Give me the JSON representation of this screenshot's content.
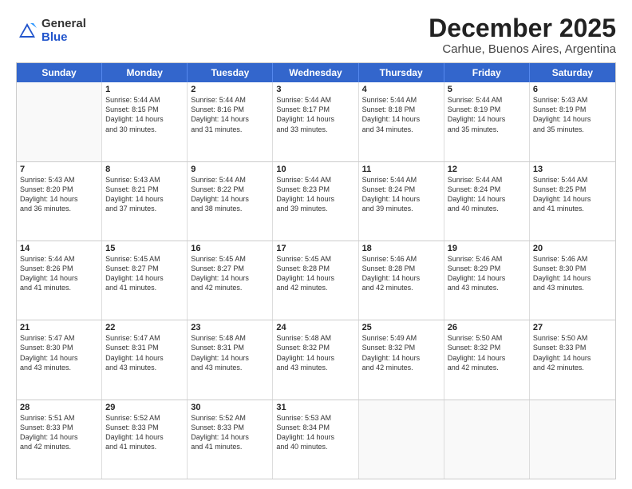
{
  "logo": {
    "general": "General",
    "blue": "Blue"
  },
  "title": "December 2025",
  "subtitle": "Carhue, Buenos Aires, Argentina",
  "days": [
    "Sunday",
    "Monday",
    "Tuesday",
    "Wednesday",
    "Thursday",
    "Friday",
    "Saturday"
  ],
  "weeks": [
    [
      {
        "day": "",
        "lines": []
      },
      {
        "day": "1",
        "lines": [
          "Sunrise: 5:44 AM",
          "Sunset: 8:15 PM",
          "Daylight: 14 hours",
          "and 30 minutes."
        ]
      },
      {
        "day": "2",
        "lines": [
          "Sunrise: 5:44 AM",
          "Sunset: 8:16 PM",
          "Daylight: 14 hours",
          "and 31 minutes."
        ]
      },
      {
        "day": "3",
        "lines": [
          "Sunrise: 5:44 AM",
          "Sunset: 8:17 PM",
          "Daylight: 14 hours",
          "and 33 minutes."
        ]
      },
      {
        "day": "4",
        "lines": [
          "Sunrise: 5:44 AM",
          "Sunset: 8:18 PM",
          "Daylight: 14 hours",
          "and 34 minutes."
        ]
      },
      {
        "day": "5",
        "lines": [
          "Sunrise: 5:44 AM",
          "Sunset: 8:19 PM",
          "Daylight: 14 hours",
          "and 35 minutes."
        ]
      },
      {
        "day": "6",
        "lines": [
          "Sunrise: 5:43 AM",
          "Sunset: 8:19 PM",
          "Daylight: 14 hours",
          "and 35 minutes."
        ]
      }
    ],
    [
      {
        "day": "7",
        "lines": [
          "Sunrise: 5:43 AM",
          "Sunset: 8:20 PM",
          "Daylight: 14 hours",
          "and 36 minutes."
        ]
      },
      {
        "day": "8",
        "lines": [
          "Sunrise: 5:43 AM",
          "Sunset: 8:21 PM",
          "Daylight: 14 hours",
          "and 37 minutes."
        ]
      },
      {
        "day": "9",
        "lines": [
          "Sunrise: 5:44 AM",
          "Sunset: 8:22 PM",
          "Daylight: 14 hours",
          "and 38 minutes."
        ]
      },
      {
        "day": "10",
        "lines": [
          "Sunrise: 5:44 AM",
          "Sunset: 8:23 PM",
          "Daylight: 14 hours",
          "and 39 minutes."
        ]
      },
      {
        "day": "11",
        "lines": [
          "Sunrise: 5:44 AM",
          "Sunset: 8:24 PM",
          "Daylight: 14 hours",
          "and 39 minutes."
        ]
      },
      {
        "day": "12",
        "lines": [
          "Sunrise: 5:44 AM",
          "Sunset: 8:24 PM",
          "Daylight: 14 hours",
          "and 40 minutes."
        ]
      },
      {
        "day": "13",
        "lines": [
          "Sunrise: 5:44 AM",
          "Sunset: 8:25 PM",
          "Daylight: 14 hours",
          "and 41 minutes."
        ]
      }
    ],
    [
      {
        "day": "14",
        "lines": [
          "Sunrise: 5:44 AM",
          "Sunset: 8:26 PM",
          "Daylight: 14 hours",
          "and 41 minutes."
        ]
      },
      {
        "day": "15",
        "lines": [
          "Sunrise: 5:45 AM",
          "Sunset: 8:27 PM",
          "Daylight: 14 hours",
          "and 41 minutes."
        ]
      },
      {
        "day": "16",
        "lines": [
          "Sunrise: 5:45 AM",
          "Sunset: 8:27 PM",
          "Daylight: 14 hours",
          "and 42 minutes."
        ]
      },
      {
        "day": "17",
        "lines": [
          "Sunrise: 5:45 AM",
          "Sunset: 8:28 PM",
          "Daylight: 14 hours",
          "and 42 minutes."
        ]
      },
      {
        "day": "18",
        "lines": [
          "Sunrise: 5:46 AM",
          "Sunset: 8:28 PM",
          "Daylight: 14 hours",
          "and 42 minutes."
        ]
      },
      {
        "day": "19",
        "lines": [
          "Sunrise: 5:46 AM",
          "Sunset: 8:29 PM",
          "Daylight: 14 hours",
          "and 43 minutes."
        ]
      },
      {
        "day": "20",
        "lines": [
          "Sunrise: 5:46 AM",
          "Sunset: 8:30 PM",
          "Daylight: 14 hours",
          "and 43 minutes."
        ]
      }
    ],
    [
      {
        "day": "21",
        "lines": [
          "Sunrise: 5:47 AM",
          "Sunset: 8:30 PM",
          "Daylight: 14 hours",
          "and 43 minutes."
        ]
      },
      {
        "day": "22",
        "lines": [
          "Sunrise: 5:47 AM",
          "Sunset: 8:31 PM",
          "Daylight: 14 hours",
          "and 43 minutes."
        ]
      },
      {
        "day": "23",
        "lines": [
          "Sunrise: 5:48 AM",
          "Sunset: 8:31 PM",
          "Daylight: 14 hours",
          "and 43 minutes."
        ]
      },
      {
        "day": "24",
        "lines": [
          "Sunrise: 5:48 AM",
          "Sunset: 8:32 PM",
          "Daylight: 14 hours",
          "and 43 minutes."
        ]
      },
      {
        "day": "25",
        "lines": [
          "Sunrise: 5:49 AM",
          "Sunset: 8:32 PM",
          "Daylight: 14 hours",
          "and 42 minutes."
        ]
      },
      {
        "day": "26",
        "lines": [
          "Sunrise: 5:50 AM",
          "Sunset: 8:32 PM",
          "Daylight: 14 hours",
          "and 42 minutes."
        ]
      },
      {
        "day": "27",
        "lines": [
          "Sunrise: 5:50 AM",
          "Sunset: 8:33 PM",
          "Daylight: 14 hours",
          "and 42 minutes."
        ]
      }
    ],
    [
      {
        "day": "28",
        "lines": [
          "Sunrise: 5:51 AM",
          "Sunset: 8:33 PM",
          "Daylight: 14 hours",
          "and 42 minutes."
        ]
      },
      {
        "day": "29",
        "lines": [
          "Sunrise: 5:52 AM",
          "Sunset: 8:33 PM",
          "Daylight: 14 hours",
          "and 41 minutes."
        ]
      },
      {
        "day": "30",
        "lines": [
          "Sunrise: 5:52 AM",
          "Sunset: 8:33 PM",
          "Daylight: 14 hours",
          "and 41 minutes."
        ]
      },
      {
        "day": "31",
        "lines": [
          "Sunrise: 5:53 AM",
          "Sunset: 8:34 PM",
          "Daylight: 14 hours",
          "and 40 minutes."
        ]
      },
      {
        "day": "",
        "lines": []
      },
      {
        "day": "",
        "lines": []
      },
      {
        "day": "",
        "lines": []
      }
    ]
  ]
}
